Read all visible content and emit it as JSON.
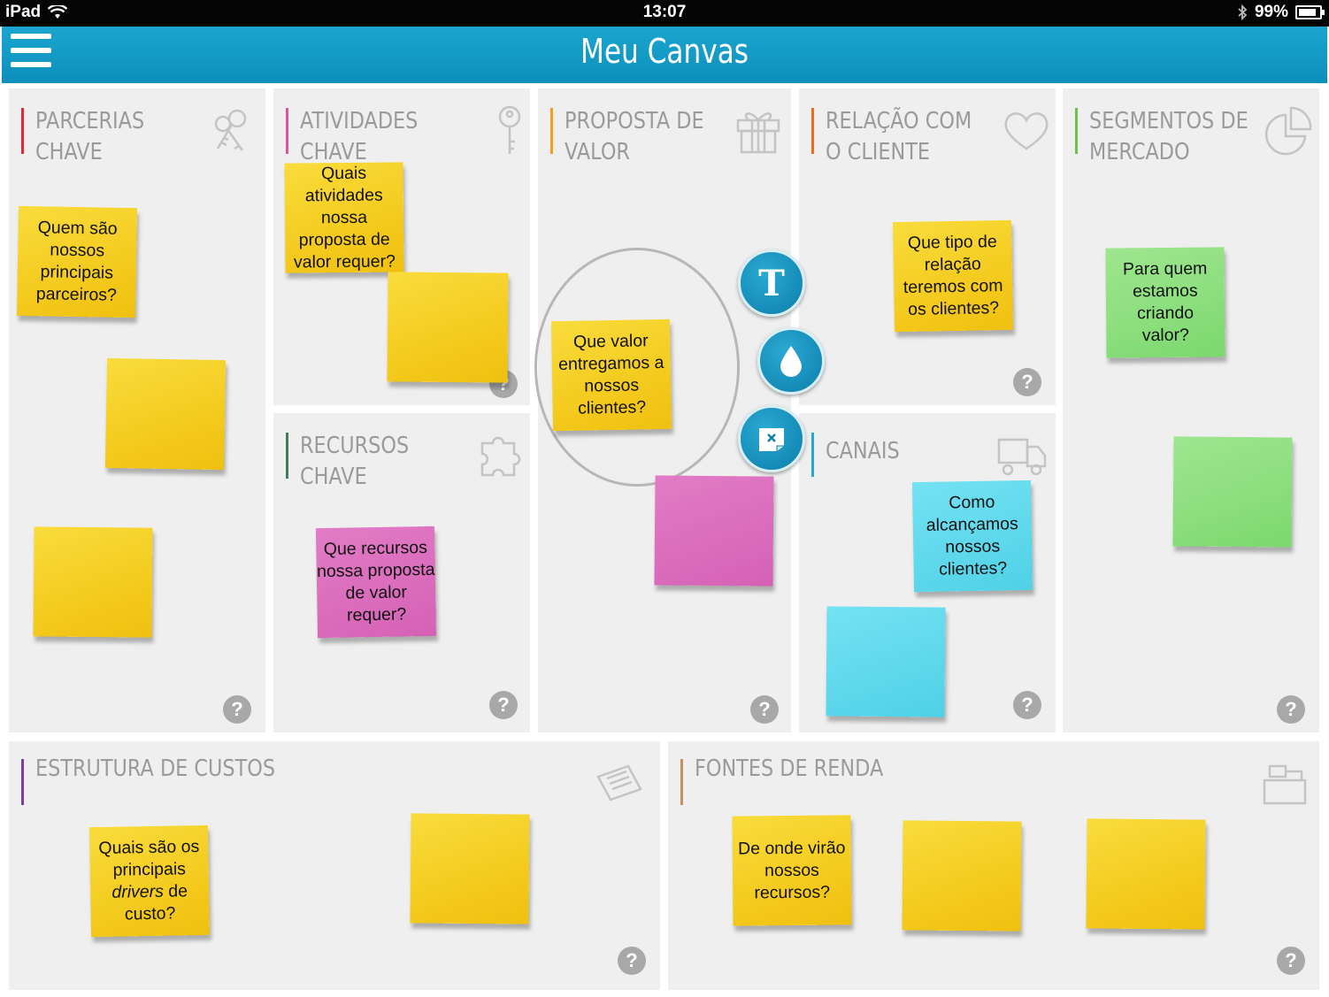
{
  "status_bar": {
    "device": "iPad",
    "time": "13:07",
    "battery": "99%"
  },
  "nav": {
    "title": "Meu Canvas"
  },
  "panels": {
    "parcerias": {
      "title": "PARCERIAS\nCHAVE",
      "color": "#e0263a"
    },
    "atividades": {
      "title": "ATIVIDADES\nCHAVE",
      "color": "#e64e9f"
    },
    "recursos": {
      "title": "RECURSOS\nCHAVE",
      "color": "#3e7c5c"
    },
    "proposta": {
      "title": "PROPOSTA DE\nVALOR",
      "color": "#f2a11f"
    },
    "relacao": {
      "title": "RELAÇÃO COM\nO CLIENTE",
      "color": "#ee6a1f"
    },
    "canais": {
      "title": "CANAIS",
      "color": "#25a6d8"
    },
    "segmentos": {
      "title": "SEGMENTOS DE\nMERCADO",
      "color": "#6cc24a"
    },
    "custos": {
      "title": "ESTRUTURA DE CUSTOS",
      "color": "#7b3f9a"
    },
    "receitas": {
      "title": "FONTES DE RENDA",
      "color": "#c8915c"
    }
  },
  "help_label": "?",
  "notes": {
    "parcerias_q": "Quem são nossos principais parceiros?",
    "atividades_q": "Quais atividades nossa proposta de valor requer?",
    "recursos_q": "Que recursos nossa proposta de valor requer?",
    "proposta_q": "Que valor entregamos a nossos clientes?",
    "relacao_q": "Que tipo de relação teremos com os clientes?",
    "canais_q": "Como alcançamos nossos clientes?",
    "segmentos_q": "Para quem estamos criando valor?",
    "custos_q1": "Quais são os principais ",
    "custos_q_em": "drivers",
    "custos_q2": " de custo?",
    "receitas_q": "De onde virão nossos recursos?"
  },
  "tools": {
    "text_tool": "T",
    "color_tool": "drop-icon",
    "delete_tool": "delete-note-icon"
  }
}
